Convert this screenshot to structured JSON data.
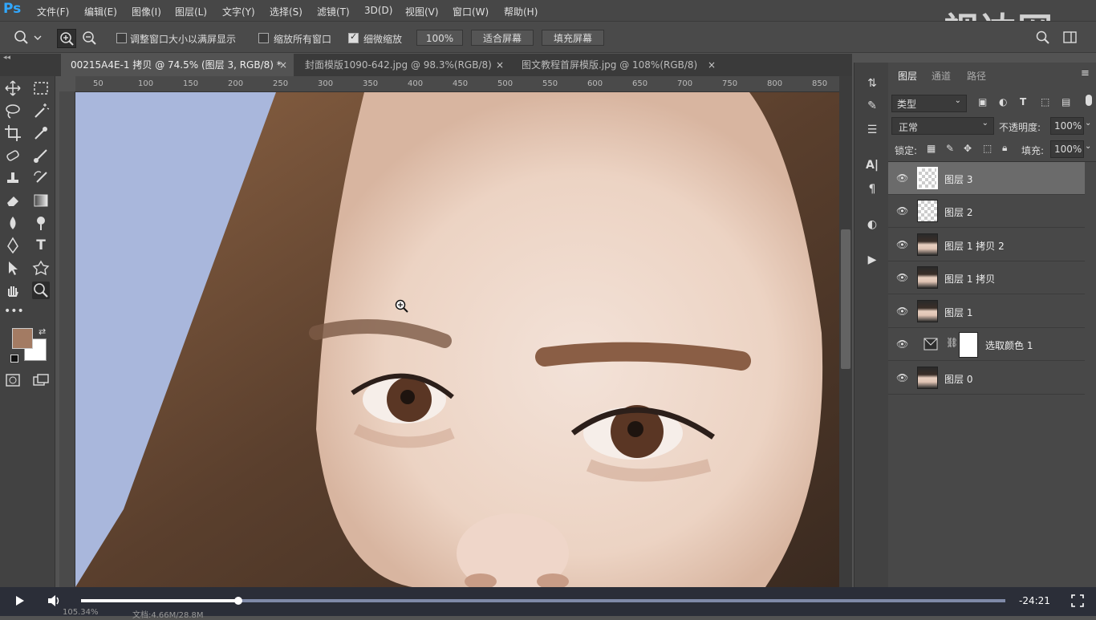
{
  "app": {
    "logo": "Ps"
  },
  "watermark": "视达网",
  "menu": [
    "文件(F)",
    "编辑(E)",
    "图像(I)",
    "图层(L)",
    "文字(Y)",
    "选择(S)",
    "滤镜(T)",
    "3D(D)",
    "视图(V)",
    "窗口(W)",
    "帮助(H)"
  ],
  "options": {
    "resize_windows_label": "调整窗口大小以满屏显示",
    "resize_windows_checked": false,
    "zoom_all_label": "缩放所有窗口",
    "zoom_all_checked": false,
    "scrubby_label": "细微缩放",
    "scrubby_checked": true,
    "zoom_value": "100%",
    "fit_screen": "适合屏幕",
    "fill_screen": "填充屏幕"
  },
  "tabs": [
    {
      "label": "00215A4E-1 拷贝 @ 74.5% (图层 3, RGB/8) *",
      "close": "×"
    },
    {
      "label": "封面模版1090-642.jpg @ 98.3%(RGB/8)",
      "close": "×"
    },
    {
      "label": "图文教程首屏模版.jpg @ 108%(RGB/8)",
      "close": "×"
    }
  ],
  "ruler_top": [
    "50",
    "100",
    "150",
    "200",
    "250",
    "300",
    "350",
    "400",
    "450",
    "500",
    "550",
    "600",
    "650",
    "700",
    "750",
    "800",
    "850"
  ],
  "colors": {
    "foreground": "#a37b63",
    "background": "#ffffff",
    "accent": "#31a8ff"
  },
  "layers_panel": {
    "tabs": [
      "图层",
      "通道",
      "路径"
    ],
    "filter_kind": "类型",
    "blend_mode": "正常",
    "opacity_label": "不透明度:",
    "opacity_value": "100%",
    "lock_label": "锁定:",
    "fill_label": "填充:",
    "fill_value": "100%",
    "layers": [
      {
        "name": "图层 3",
        "thumb": "transparent",
        "selected": true
      },
      {
        "name": "图层 2",
        "thumb": "transparent",
        "selected": false
      },
      {
        "name": "图层 1 拷贝 2",
        "thumb": "photo",
        "selected": false
      },
      {
        "name": "图层 1 拷贝",
        "thumb": "photo",
        "selected": false
      },
      {
        "name": "图层 1",
        "thumb": "photo",
        "selected": false
      },
      {
        "name": "选取颜色 1",
        "thumb": "adjustment",
        "selected": false
      },
      {
        "name": "图层 0",
        "thumb": "photo",
        "selected": false
      }
    ]
  },
  "video": {
    "time": "-24:21",
    "progress": 0.17
  },
  "status": {
    "zoom": "105.34%",
    "doc": "文档:4.66M/28.8M"
  }
}
